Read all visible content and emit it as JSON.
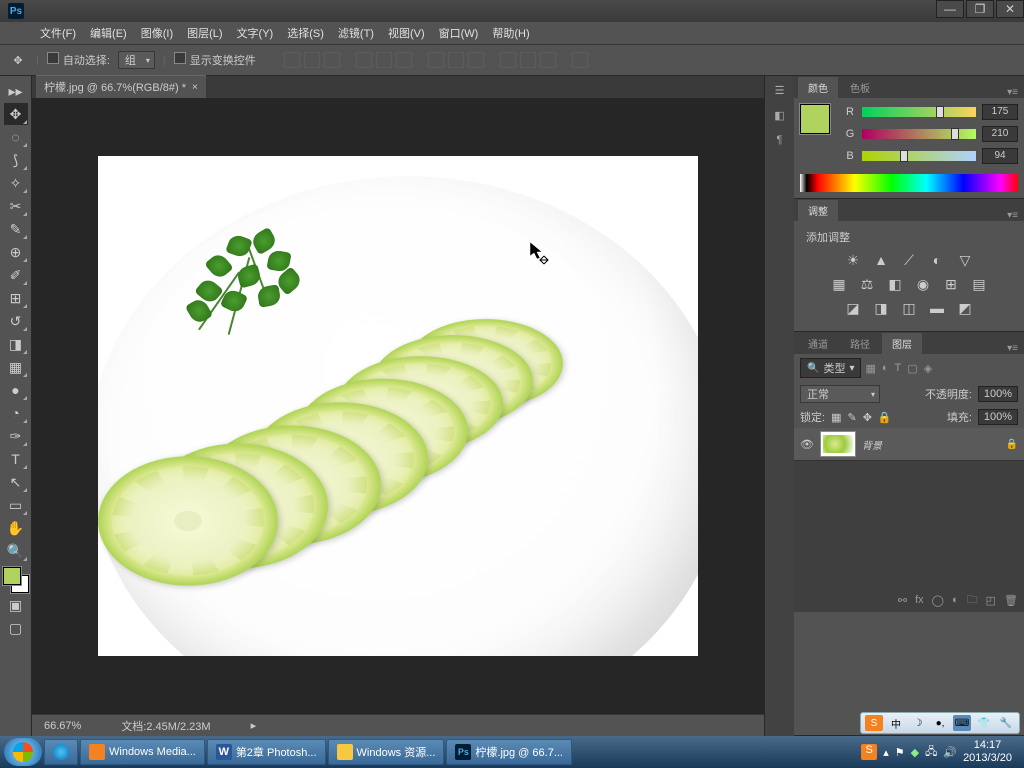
{
  "titlebar": {
    "app": "Ps"
  },
  "menubar": {
    "items": [
      "文件(F)",
      "编辑(E)",
      "图像(I)",
      "图层(L)",
      "文字(Y)",
      "选择(S)",
      "滤镜(T)",
      "视图(V)",
      "窗口(W)",
      "帮助(H)"
    ]
  },
  "optbar": {
    "auto_select": "自动选择:",
    "group": "组",
    "show_transform": "显示变换控件"
  },
  "doc": {
    "tab": "柠檬.jpg @ 66.7%(RGB/8#) *"
  },
  "status": {
    "zoom": "66.67%",
    "docinfo": "文档:2.45M/2.23M"
  },
  "color": {
    "tab1": "颜色",
    "tab2": "色板",
    "r_label": "R",
    "g_label": "G",
    "b_label": "B",
    "r": "175",
    "g": "210",
    "b": "94"
  },
  "adjust": {
    "tab": "调整",
    "title": "添加调整"
  },
  "layers": {
    "tab1": "通道",
    "tab2": "路径",
    "tab3": "图层",
    "type": "类型",
    "blend": "正常",
    "opacity_label": "不透明度:",
    "opacity": "100%",
    "lock_label": "锁定:",
    "fill_label": "填充:",
    "fill": "100%",
    "layer_name": "背景"
  },
  "ime": {
    "zhong": "中"
  },
  "taskbar": {
    "items": [
      {
        "icon": "#2a8dd4",
        "label": ""
      },
      {
        "icon": "#f58220",
        "label": "Windows Media..."
      },
      {
        "icon": "#2b579a",
        "label": "第2章 Photosh..."
      },
      {
        "icon": "#f8c840",
        "label": "Windows 资源..."
      },
      {
        "icon": "#001d33",
        "label": "柠檬.jpg @ 66.7..."
      }
    ],
    "sogou": "S",
    "time": "14:17",
    "date": "2013/3/20"
  }
}
